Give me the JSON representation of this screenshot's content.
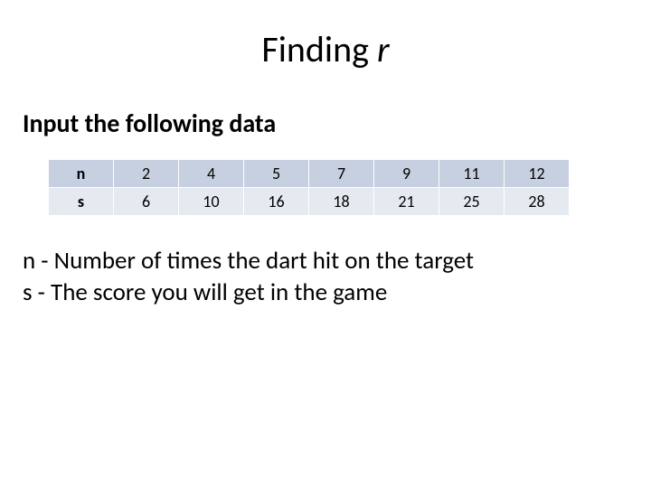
{
  "title_prefix": "Finding ",
  "title_var": "r",
  "subtitle": "Input the following data",
  "table": {
    "rows": [
      {
        "label": "n",
        "values": [
          "2",
          "4",
          "5",
          "7",
          "9",
          "11",
          "12"
        ]
      },
      {
        "label": "s",
        "values": [
          "6",
          "10",
          "16",
          "18",
          "21",
          "25",
          "28"
        ]
      }
    ]
  },
  "legend": {
    "line1": "n - Number of times the dart hit on the target",
    "line2": "s - The score you will get in the game"
  }
}
